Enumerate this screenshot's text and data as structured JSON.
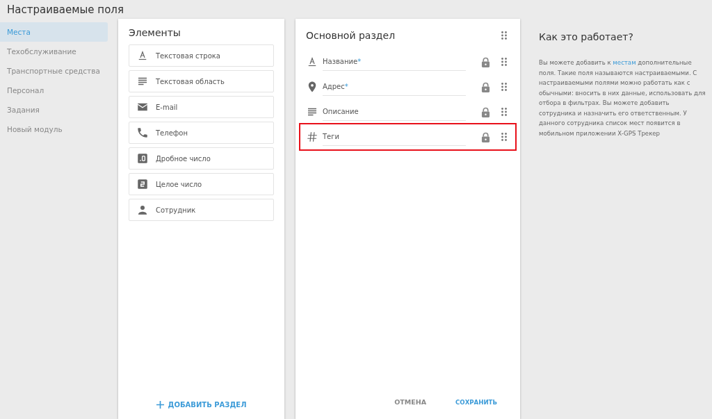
{
  "page_title": "Настраиваемые поля",
  "sidebar": {
    "items": [
      {
        "label": "Места",
        "selected": true
      },
      {
        "label": "Техобслуживание",
        "selected": false
      },
      {
        "label": "Транспортные средства",
        "selected": false
      },
      {
        "label": "Персонал",
        "selected": false
      },
      {
        "label": "Задания",
        "selected": false
      },
      {
        "label": "Новый модуль",
        "selected": false
      }
    ]
  },
  "elements_panel": {
    "title": "Элементы",
    "items": [
      {
        "label": "Текстовая строка",
        "kind": "text-line"
      },
      {
        "label": "Текстовая область",
        "kind": "text-area"
      },
      {
        "label": "E-mail",
        "kind": "email"
      },
      {
        "label": "Телефон",
        "kind": "phone"
      },
      {
        "label": "Дробное число",
        "kind": "decimal"
      },
      {
        "label": "Целое число",
        "kind": "integer"
      },
      {
        "label": "Сотрудник",
        "kind": "person"
      }
    ],
    "add_section_button": "ДОБАВИТЬ РАЗДЕЛ"
  },
  "section_panel": {
    "title": "Основной раздел",
    "required_mark": "*",
    "fields": [
      {
        "label": "Название",
        "kind": "text-line",
        "required": true,
        "highlighted": false
      },
      {
        "label": "Адрес",
        "kind": "location",
        "required": true,
        "highlighted": false
      },
      {
        "label": "Описание",
        "kind": "text-area",
        "required": false,
        "highlighted": false
      },
      {
        "label": "Теги",
        "kind": "hash",
        "required": false,
        "highlighted": true
      }
    ],
    "cancel_button": "ОТМЕНА",
    "save_button": "СОХРАНИТЬ"
  },
  "help": {
    "title": "Как это работает?",
    "text_before_link": "Вы можете добавить к",
    "link": "местам",
    "text_after_link": "дополнительные поля. Такие поля называются настраиваемыми. С настраиваемыми полями можно работать как с обычными: вносить в них данные, использовать для отбора в фильтрах. Вы можете добавить сотрудника и назначить его ответственным. У данного сотрудника список мест появится в мобильном приложении X-GPS Трекер"
  }
}
